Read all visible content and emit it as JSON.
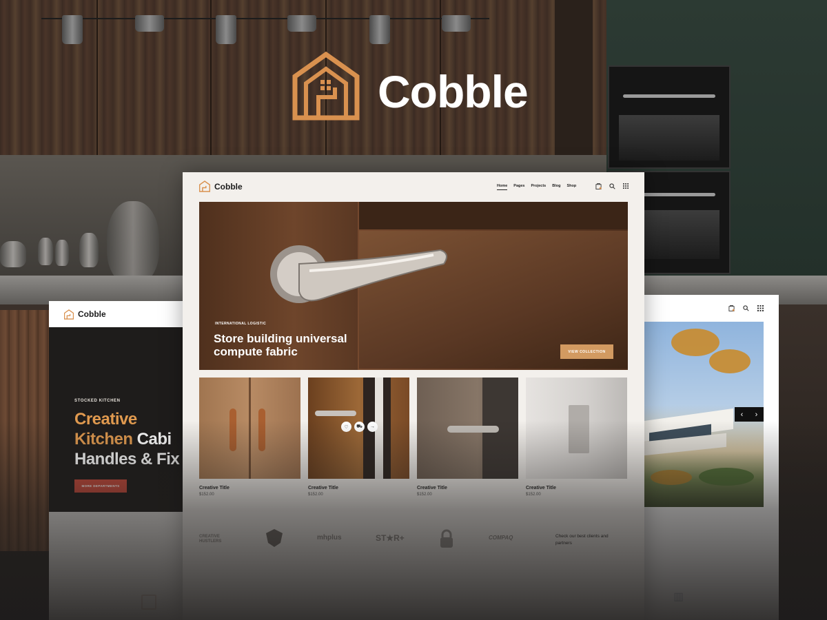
{
  "brand": {
    "name": "Cobble",
    "accent": "#D9914F"
  },
  "center": {
    "brand": "Cobble",
    "nav": [
      "Home",
      "Pages",
      "Projects",
      "Blog",
      "Shop"
    ],
    "hero": {
      "tag": "INTERNATIONAL LOGISTIC",
      "title": "Store building universal compute fabric",
      "button": "VIEW COLLECTION"
    },
    "products": [
      {
        "title": "Creative Title",
        "price": "$152.00"
      },
      {
        "title": "Creative Title",
        "price": "$152.00"
      },
      {
        "title": "Creative Title",
        "price": "$152.00"
      },
      {
        "title": "Creative Title",
        "price": "$152.00"
      }
    ],
    "clients": {
      "logos": [
        "CREATIVE HUSTLERS",
        "mhplus",
        "ST★R+",
        "COMPAQ"
      ],
      "text": "Check our best clients and partners"
    }
  },
  "left": {
    "brand": "Cobble",
    "tag": "STOCKED KITCHEN",
    "title_l1_orange": "Creative",
    "title_l2_orange": "Kitchen",
    "title_l2_white": " Cabi",
    "title_l3": "Handles & Fix",
    "button": "MORE DEPARTMENTS"
  },
  "icons": [
    "house-logo-icon",
    "bag-icon",
    "search-icon",
    "grid-icon",
    "heart-icon",
    "cart-icon",
    "arrow-icon",
    "chevron-left-icon",
    "chevron-right-icon"
  ]
}
